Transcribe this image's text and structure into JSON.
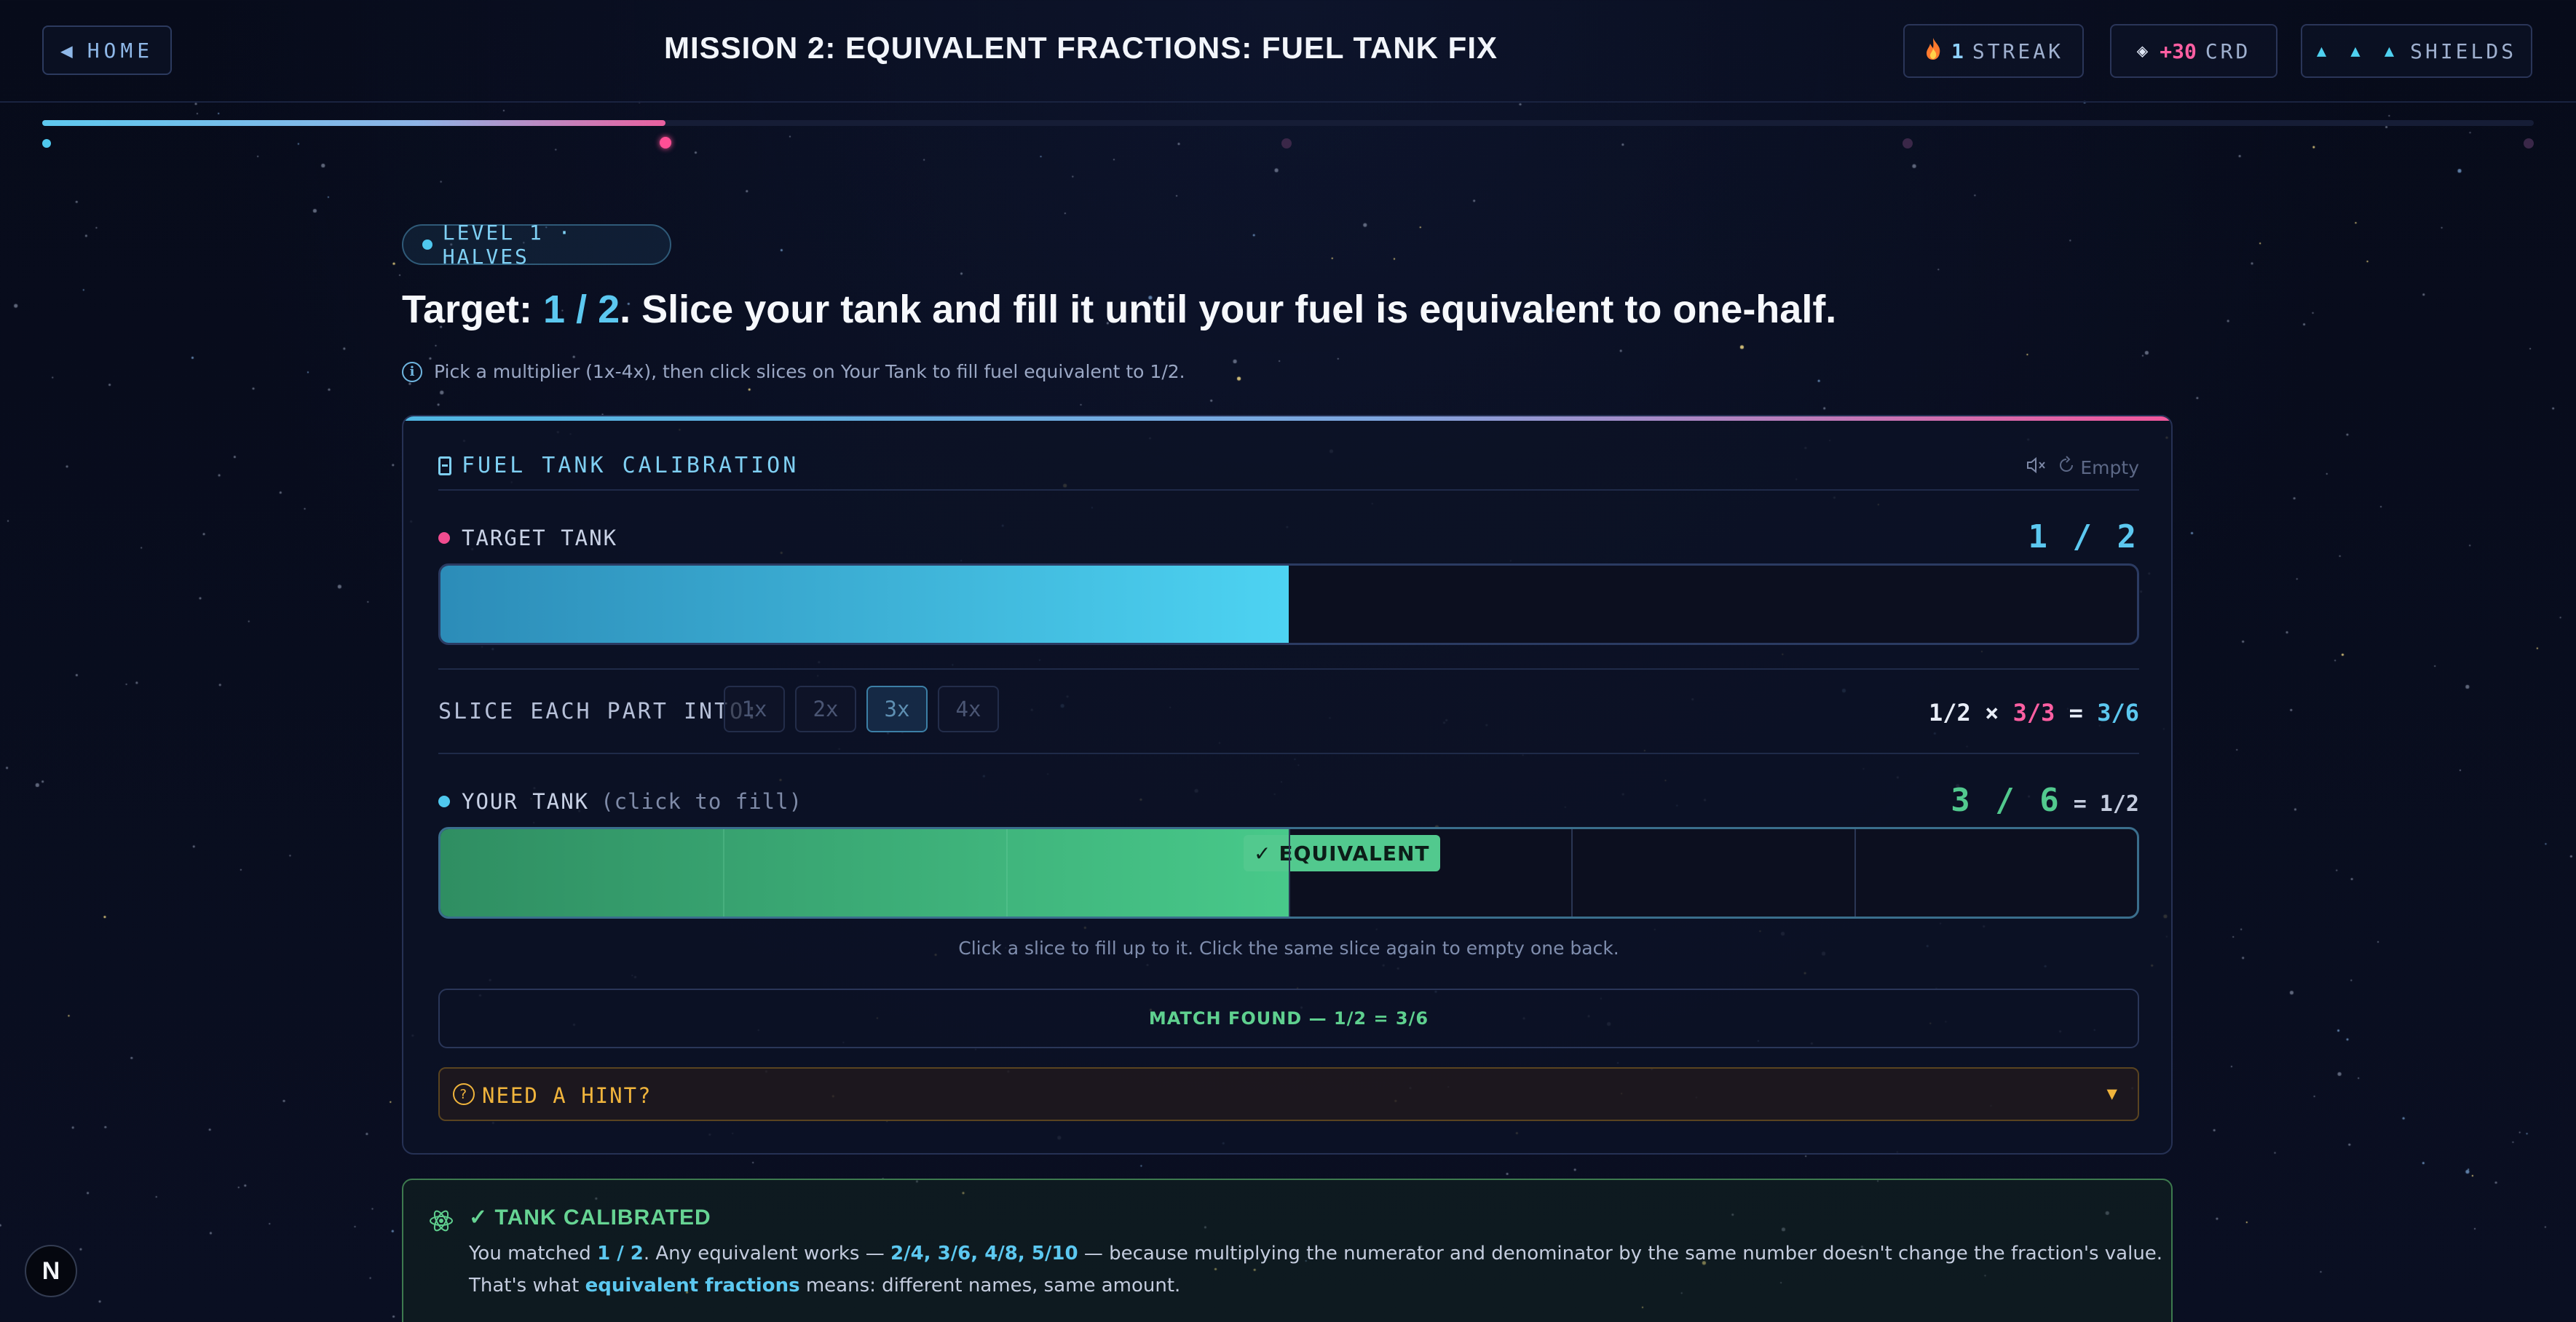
{
  "topbar": {
    "home_label": "HOME",
    "mission_title": "MISSION 2: EQUIVALENT FRACTIONS: FUEL TANK FIX",
    "streak_value": "1",
    "streak_label": "STREAK",
    "credits_value": "+30",
    "credits_label": "CRD",
    "shields_icons": "▲ ▲ ▲",
    "shields_label": "SHIELDS"
  },
  "progress": {
    "fraction_complete": 0.25,
    "steps_total": 5,
    "current_step": 2
  },
  "level": {
    "badge": "LEVEL 1 · HALVES"
  },
  "prompt": {
    "target_prefix": "Target:",
    "target_fraction": "1 / 2",
    "target_rest": ". Slice your tank and fill it until your fuel is equivalent to one-half.",
    "info": "Pick a multiplier (1x-4x), then click slices on Your Tank to fill fuel equivalent to 1/2."
  },
  "card": {
    "title": "FUEL TANK CALIBRATION",
    "empty_label": "Empty",
    "target_tank": {
      "label": "TARGET TANK",
      "fraction": "1 / 2",
      "fill": 0.5
    },
    "slice": {
      "label": "SLICE EACH PART INTO:",
      "options": [
        "1x",
        "2x",
        "3x",
        "4x"
      ],
      "selected": "3x",
      "eq_base": "1/2 ×",
      "eq_mult": "3/3",
      "eq_equals": "=",
      "eq_result": "3/6"
    },
    "your_tank": {
      "label": "YOUR TANK",
      "sub": "(click to fill)",
      "fraction": "3 / 6",
      "equals": "= 1/2",
      "slices": 6,
      "filled": 3,
      "badge": "EQUIVALENT"
    },
    "helper": "Click a slice to fill up to it. Click the same slice again to empty one back.",
    "match": "MATCH FOUND — 1/2 = 3/6",
    "hint": "NEED A HINT?"
  },
  "result": {
    "title": "TANK CALIBRATED",
    "line1_a": "You matched ",
    "line1_frac": "1 / 2",
    "line1_b": ". Any equivalent works — ",
    "line1_list": "2/4, 3/6, 4/8, 5/10",
    "line1_c": " — because multiplying the numerator and denominator by the same number doesn't change the fraction's value.",
    "line2_a": "That's what ",
    "line2_term": "equivalent fractions",
    "line2_b": " means: different names, same amount."
  },
  "corner_badge": "N",
  "colors": {
    "accent_cyan": "#5cc8f0",
    "accent_pink": "#ff5fa2",
    "success_green": "#52c98e",
    "hint_amber": "#f0b43c"
  }
}
